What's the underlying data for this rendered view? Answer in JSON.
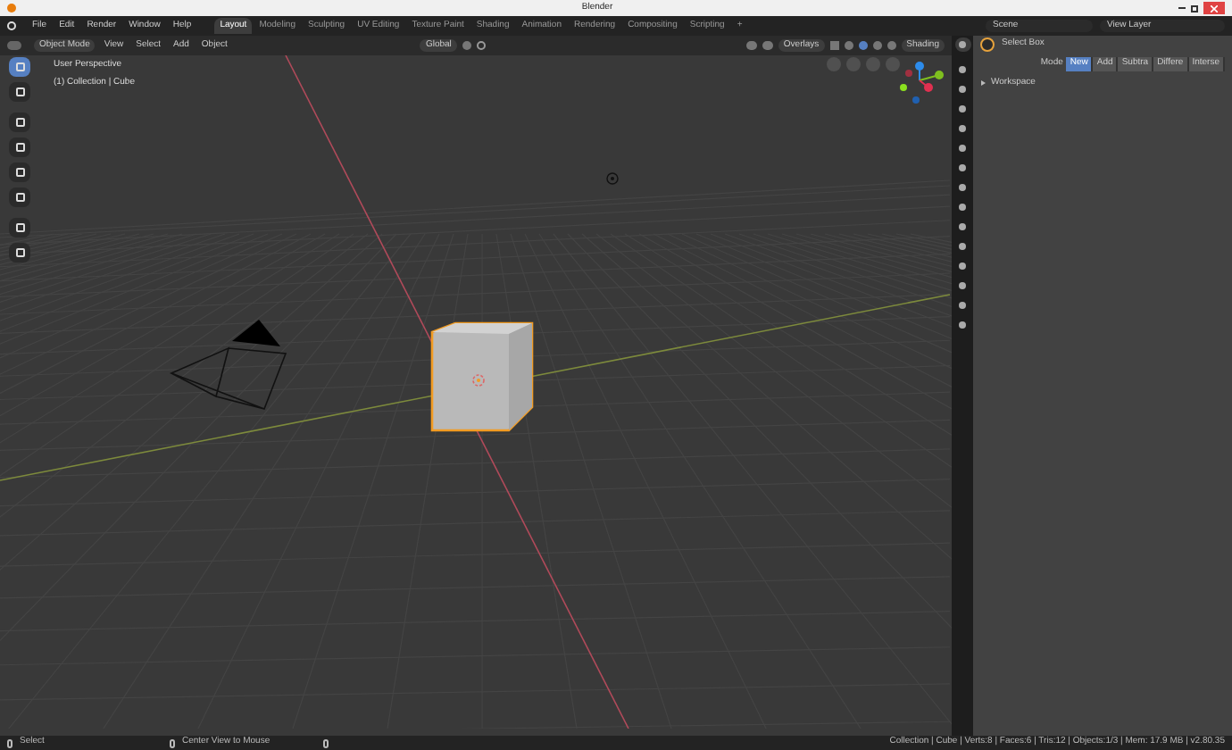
{
  "window": {
    "title": "Blender"
  },
  "menu": [
    "File",
    "Edit",
    "Render",
    "Window",
    "Help"
  ],
  "workspace_tabs": [
    {
      "label": "Layout",
      "selected": true
    },
    {
      "label": "Modeling",
      "selected": false
    },
    {
      "label": "Sculpting",
      "selected": false
    },
    {
      "label": "UV Editing",
      "selected": false
    },
    {
      "label": "Texture Paint",
      "selected": false
    },
    {
      "label": "Shading",
      "selected": false
    },
    {
      "label": "Animation",
      "selected": false
    },
    {
      "label": "Rendering",
      "selected": false
    },
    {
      "label": "Compositing",
      "selected": false
    },
    {
      "label": "Scripting",
      "selected": false
    },
    {
      "label": "+",
      "selected": false
    }
  ],
  "scene": "Scene",
  "view_layer": "View Layer",
  "viewport_header": {
    "mode": "Object Mode",
    "menus": [
      "View",
      "Select",
      "Add",
      "Object"
    ],
    "orientation": "Global",
    "overlays": "Overlays",
    "shading": "Shading"
  },
  "viewport_info": [
    "User Perspective",
    "(1) Collection | Cube"
  ],
  "tools": [
    {
      "selected": true
    },
    {
      "selected": false
    },
    {
      "selected": false
    },
    {
      "selected": false
    },
    {
      "selected": false
    },
    {
      "selected": false
    },
    {
      "selected": false
    },
    {
      "selected": false
    }
  ],
  "properties_tabs": [
    {
      "selected": true
    },
    {
      "selected": false
    },
    {
      "selected": false
    },
    {
      "selected": false
    },
    {
      "selected": false
    },
    {
      "selected": false
    },
    {
      "selected": false
    },
    {
      "selected": false
    },
    {
      "selected": false
    },
    {
      "selected": false
    },
    {
      "selected": false
    },
    {
      "selected": false
    },
    {
      "selected": false
    },
    {
      "selected": false
    },
    {
      "selected": false
    }
  ],
  "properties": {
    "tool": "Select Box",
    "mode_label": "Mode",
    "modes": [
      {
        "label": "New",
        "selected": true
      },
      {
        "label": "Add",
        "selected": false
      },
      {
        "label": "Subtra",
        "selected": false
      },
      {
        "label": "Differe",
        "selected": false
      },
      {
        "label": "Interse",
        "selected": false
      }
    ],
    "section": {
      "label": "Workspace",
      "expanded": false
    }
  },
  "status_bar": {
    "left": "Select",
    "middle": "Center View to Mouse",
    "stats": "Collection | Cube | Verts:8 | Faces:6 | Tris:12 | Objects:1/3 | Mem: 17.9 MB | v2.80.35"
  }
}
